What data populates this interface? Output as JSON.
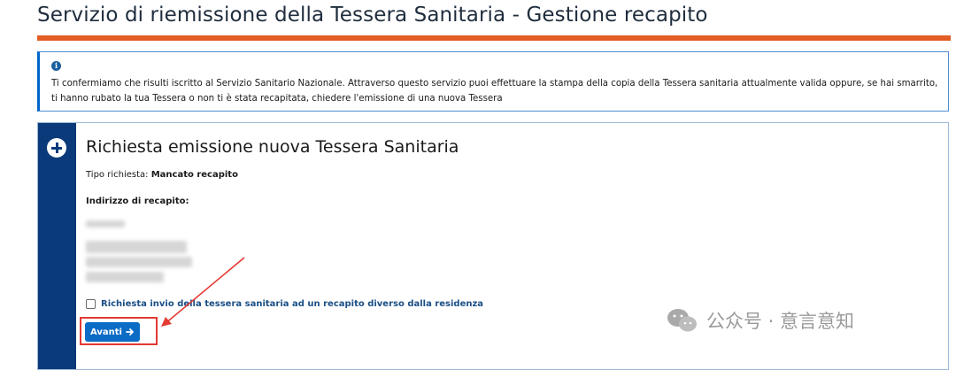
{
  "page": {
    "title": "Servizio di riemissione della Tessera Sanitaria - Gestione recapito"
  },
  "info": {
    "icon": "info-icon",
    "text": "Ti confermiamo che risulti iscritto al Servizio Sanitario Nazionale. Attraverso questo servizio puoi effettuare la stampa della copia della Tessera sanitaria attualmente valida oppure, se hai smarrito, ti hanno rubato la tua Tessera o non ti è stata recapitata, chiedere l'emissione di una nuova Tessera"
  },
  "card": {
    "icon": "plus-circle-icon",
    "title": "Richiesta emissione nuova Tessera Sanitaria",
    "request_type_label": "Tipo richiesta:",
    "request_type_value": "Mancato recapito",
    "address_label": "Indirizzo di recapito:",
    "checkbox_label": "Richiesta invio della tessera sanitaria ad un recapito diverso dalla residenza",
    "checkbox_checked": false,
    "next_button": "Avanti",
    "next_button_icon": "arrow-right-icon"
  },
  "watermark": {
    "icon": "wechat-icon",
    "text": "公众号 · 意言意知"
  },
  "colors": {
    "accent_rule": "#e35d25",
    "rail": "#0a3a7a",
    "button": "#0b6cc6",
    "annotation": "#e33a33"
  }
}
